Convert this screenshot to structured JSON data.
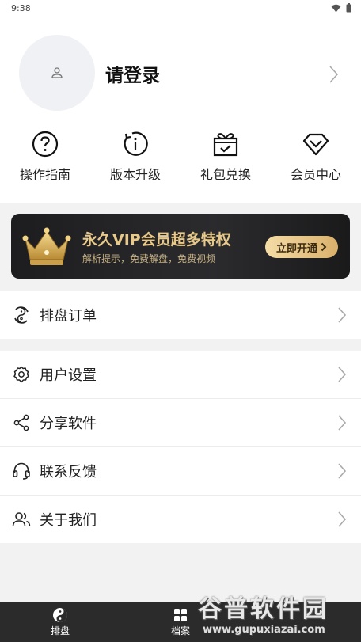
{
  "status_bar": {
    "time": "9:38",
    "wifi_icon": "wifi-icon",
    "battery_icon": "battery-icon"
  },
  "profile": {
    "avatar_icon": "user-icon",
    "login_text": "请登录",
    "chevron_icon": "chevron-right-icon"
  },
  "quick_actions": [
    {
      "label": "操作指南",
      "icon": "help-circle-icon"
    },
    {
      "label": "版本升级",
      "icon": "info-refresh-icon"
    },
    {
      "label": "礼包兑换",
      "icon": "gift-icon"
    },
    {
      "label": "会员中心",
      "icon": "diamond-icon"
    }
  ],
  "vip_banner": {
    "title": "永久VIP会员超多特权",
    "subtitle": "解析提示，免费解盘，免费视频",
    "button_label": "立即开通",
    "crown_icon": "crown-icon",
    "colors": {
      "gold": "#e8c98a",
      "dark": "#1d1d1f"
    }
  },
  "menu_group_1": [
    {
      "label": "排盘订单",
      "icon": "order-cycle-icon"
    }
  ],
  "menu_group_2": [
    {
      "label": "用户设置",
      "icon": "gear-icon"
    },
    {
      "label": "分享软件",
      "icon": "share-icon"
    },
    {
      "label": "联系反馈",
      "icon": "headset-icon"
    },
    {
      "label": "关于我们",
      "icon": "users-icon"
    }
  ],
  "tab_bar": [
    {
      "label": "排盘",
      "icon": "yin-yang-icon"
    },
    {
      "label": "档案",
      "icon": "grid-icon"
    }
  ],
  "watermark": {
    "text": "谷普软件园",
    "url": "www.gupuxiazai.com"
  }
}
